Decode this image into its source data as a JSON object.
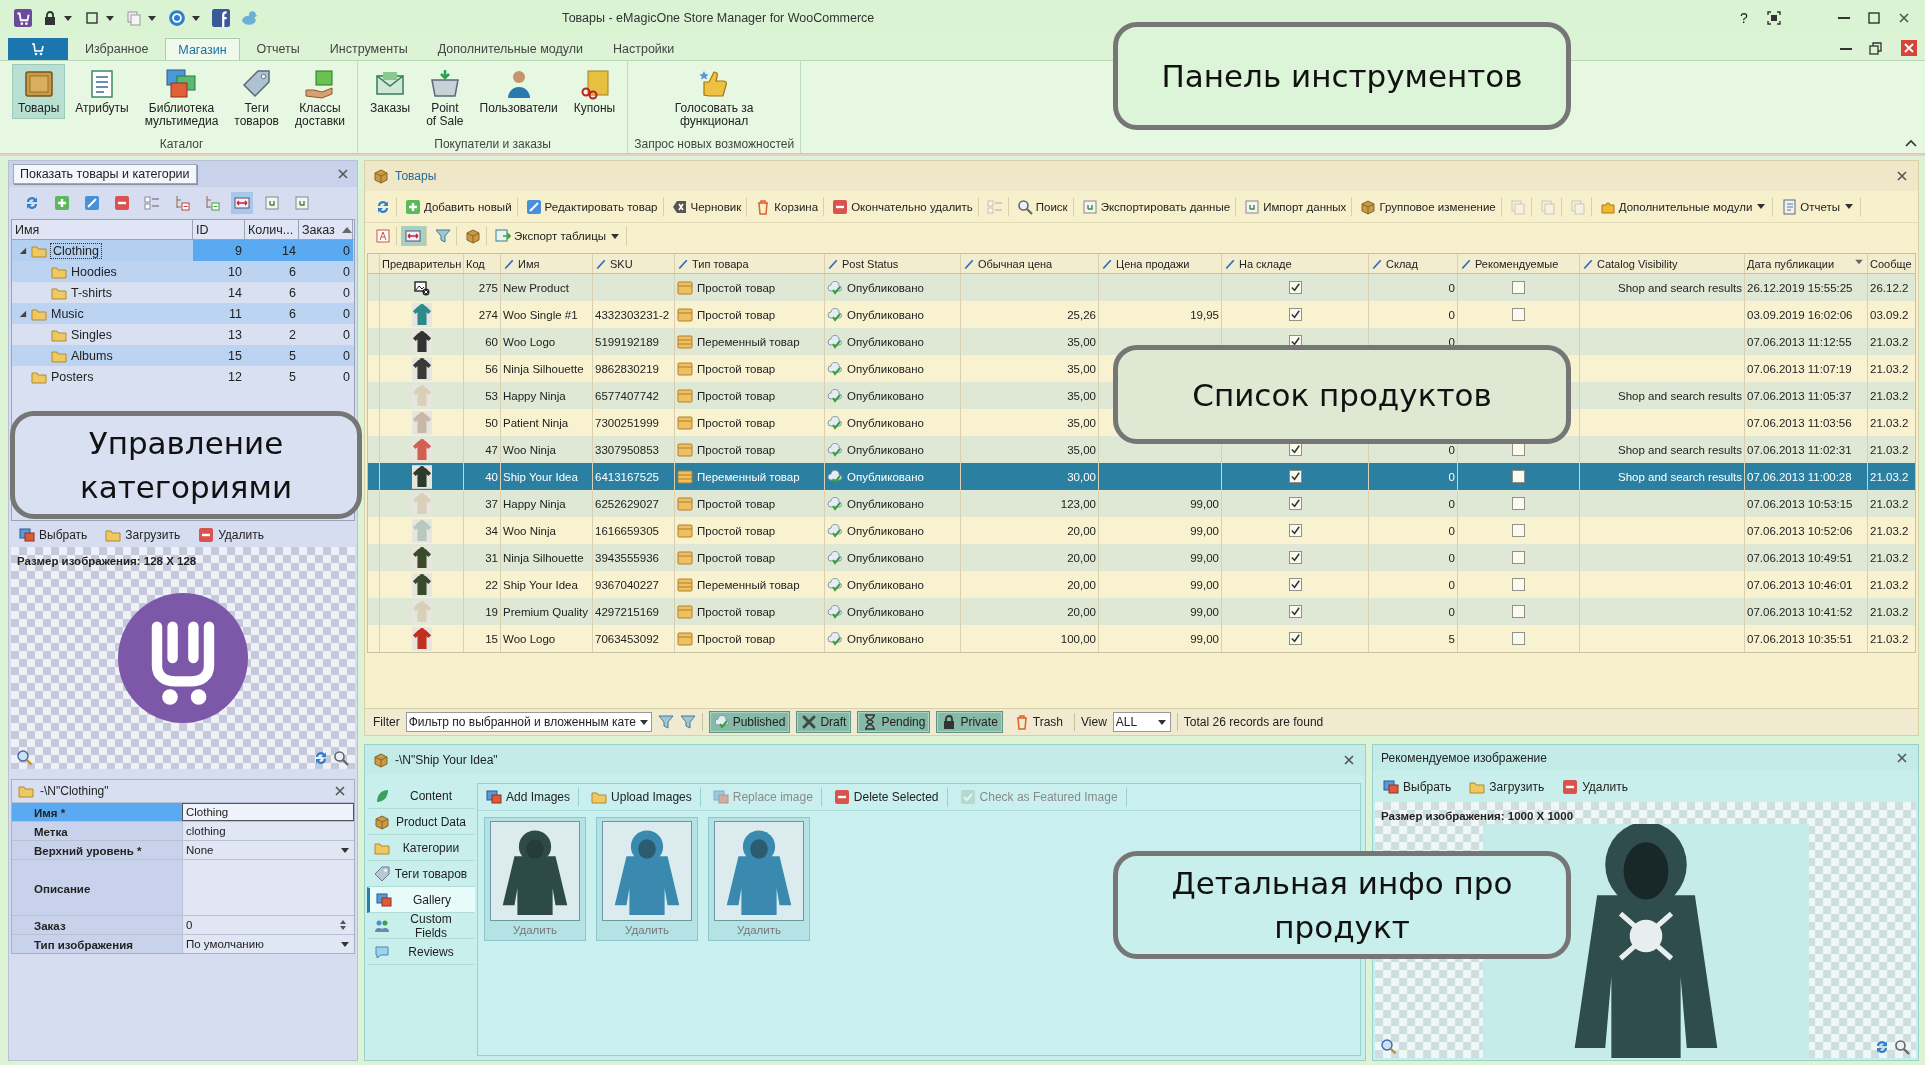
{
  "window": {
    "title": "Товары - eMagicOne Store Manager for WooCommerce",
    "help_button": "?"
  },
  "ribbon": {
    "tabs": [
      {
        "label": "Избранное",
        "selected": false
      },
      {
        "label": "Магазин",
        "selected": true
      },
      {
        "label": "Отчеты",
        "selected": false
      },
      {
        "label": "Инструменты",
        "selected": false
      },
      {
        "label": "Дополнительные модули",
        "selected": false
      },
      {
        "label": "Настройки",
        "selected": false
      }
    ],
    "groups": [
      {
        "label": "Каталог",
        "buttons": [
          {
            "label": "Товары",
            "selected": true
          },
          {
            "label": "Атрибуты",
            "selected": false
          },
          {
            "label": "Библиотека\nмультимедиа",
            "selected": false
          },
          {
            "label": "Теги\nтоваров",
            "selected": false
          },
          {
            "label": "Классы\nдоставки",
            "selected": false
          }
        ]
      },
      {
        "label": "Покупатели и заказы",
        "buttons": [
          {
            "label": "Заказы",
            "selected": false
          },
          {
            "label": "Point\nof Sale",
            "selected": false
          },
          {
            "label": "Пользователи",
            "selected": false
          },
          {
            "label": "Купоны",
            "selected": false
          }
        ]
      },
      {
        "label": "Запрос новых возможностей",
        "buttons": [
          {
            "label": "Голосовать за\nфункционал",
            "selected": false
          }
        ]
      }
    ]
  },
  "callouts": [
    "Панель инструментов",
    "Управление категориями",
    "Список продуктов",
    "Детальная инфо про продукт"
  ],
  "category_panel": {
    "title": "Показать товары и категории",
    "columns": [
      "Имя",
      "ID",
      "Колич...",
      "Заказ"
    ],
    "categories": [
      {
        "name": "Clothing",
        "id": "9",
        "count": "14",
        "order": "0",
        "selected": true,
        "expanded": true,
        "children": [
          {
            "name": "Hoodies",
            "id": "10",
            "count": "6",
            "order": "0",
            "selected": false
          },
          {
            "name": "T-shirts",
            "id": "14",
            "count": "6",
            "order": "0",
            "selected": false
          }
        ]
      },
      {
        "name": "Music",
        "id": "11",
        "count": "6",
        "order": "0",
        "selected": false,
        "expanded": true,
        "children": [
          {
            "name": "Singles",
            "id": "13",
            "count": "2",
            "order": "0",
            "selected": false
          },
          {
            "name": "Albums",
            "id": "15",
            "count": "5",
            "order": "0",
            "selected": false
          }
        ]
      },
      {
        "name": "Posters",
        "id": "12",
        "count": "5",
        "order": "0",
        "selected": false
      }
    ],
    "image_toolbar": [
      "Выбрать",
      "Загрузить",
      "Удалить"
    ],
    "image_size": "Размер изображения: 128 X 128"
  },
  "properties": {
    "title": "-\\N\"Clothing\"",
    "rows": [
      {
        "label": "Имя *",
        "value": "Clothing",
        "kind": "text",
        "selected": true
      },
      {
        "label": "Метка",
        "value": "clothing",
        "kind": "text",
        "selected": false
      },
      {
        "label": "Верхний уровень *",
        "value": "None",
        "kind": "dropdown",
        "selected": false
      },
      {
        "label": "Описание",
        "kind": "memo",
        "selected": false
      },
      {
        "label": "Заказ",
        "value": "0",
        "kind": "spin",
        "selected": false
      },
      {
        "label": "Тип изображения",
        "value": "По умолчанию",
        "kind": "dropdown",
        "selected": false
      }
    ]
  },
  "products": {
    "title": "Товары",
    "toolbar": [
      {
        "disabled": false,
        "dropdown": false
      },
      {
        "label": "Добавить новый",
        "disabled": false,
        "dropdown": false
      },
      {
        "label": "Редактировать товар",
        "disabled": false,
        "dropdown": false
      },
      {
        "label": "Черновик",
        "disabled": false,
        "dropdown": false
      },
      {
        "label": "Корзина",
        "disabled": false,
        "dropdown": false
      },
      {
        "label": "Окончательно удалить",
        "disabled": false,
        "dropdown": false
      },
      {
        "disabled": true,
        "dropdown": false
      },
      {
        "label": "Поиск",
        "disabled": false,
        "dropdown": false
      },
      {
        "label": "Экспортировать данные",
        "disabled": false,
        "dropdown": false
      },
      {
        "label": "Импорт данных",
        "disabled": false,
        "dropdown": false
      },
      {
        "label": "Групповое изменение",
        "disabled": false,
        "dropdown": false
      },
      {
        "disabled": true,
        "dropdown": false
      },
      {
        "disabled": true,
        "dropdown": false
      },
      {
        "disabled": true,
        "dropdown": false
      },
      {
        "label": "Дополнительные модули",
        "disabled": false,
        "dropdown": true
      },
      {
        "label": "Отчеты",
        "disabled": false,
        "dropdown": true
      }
    ],
    "toolbar_2": [
      {
        "selected": false,
        "dropdown": false
      },
      {
        "selected": true,
        "dropdown": false
      },
      {
        "selected": false,
        "dropdown": false
      },
      {
        "selected": false,
        "dropdown": false
      },
      {
        "label": "Экспорт таблицы",
        "selected": false,
        "dropdown": true
      }
    ],
    "columns": [
      {
        "label": "Предварительн",
        "editable": false,
        "sorted": false
      },
      {
        "label": "Код",
        "editable": false,
        "sorted": false
      },
      {
        "label": "Имя",
        "editable": true,
        "sorted": false
      },
      {
        "label": "SKU",
        "editable": true,
        "sorted": false
      },
      {
        "label": "Тип товара",
        "editable": true,
        "sorted": false
      },
      {
        "label": "Post Status",
        "editable": true,
        "sorted": false
      },
      {
        "label": "Обычная цена",
        "editable": true,
        "sorted": false
      },
      {
        "label": "Цена продажи",
        "editable": true,
        "sorted": false
      },
      {
        "label": "На складе",
        "editable": true,
        "sorted": false
      },
      {
        "label": "Склад",
        "editable": true,
        "sorted": false
      },
      {
        "label": "Рекомендуемые",
        "editable": true,
        "sorted": false
      },
      {
        "label": "Catalog Visibility",
        "editable": true,
        "sorted": false
      },
      {
        "label": "Дата публикации",
        "editable": false,
        "sorted": true
      },
      {
        "label": "Сообще",
        "editable": false,
        "sorted": false
      }
    ],
    "rows": [
      {
        "preview": {
          "kind": "missing"
        },
        "code": "275",
        "name": "New Product",
        "type": {
          "label": "Простой товар",
          "kind": "simple"
        },
        "status": "Опубликовано",
        "in_stock": true,
        "stock": "0",
        "featured": false,
        "visibility": "Shop and search results",
        "date": "26.12.2019 15:55:25",
        "column_14": "26.12.2",
        "selected": false
      },
      {
        "code": "274",
        "name": "Woo Single #1",
        "sku": "4332303231-2",
        "type": {
          "label": "Простой товар",
          "kind": "simple"
        },
        "status": "Опубликовано",
        "regular_price": "25,26",
        "sale_price": "19,95",
        "in_stock": true,
        "stock": "0",
        "featured": false,
        "date": "03.09.2019 16:02:06",
        "column_14": "03.09.2",
        "selected": false
      },
      {
        "code": "60",
        "name": "Woo Logo",
        "sku": "5199192189",
        "type": {
          "label": "Переменный товар",
          "kind": "variable"
        },
        "status": "Опубликовано",
        "regular_price": "35,00",
        "in_stock": true,
        "stock": "0",
        "date": "07.06.2013 11:12:55",
        "column_14": "21.03.2",
        "selected": false
      },
      {
        "code": "56",
        "name": "Ninja Silhouette",
        "sku": "9862830219",
        "type": {
          "label": "Простой товар",
          "kind": "simple"
        },
        "status": "Опубликовано",
        "regular_price": "35,00",
        "date": "07.06.2013 11:07:19",
        "column_14": "21.03.2",
        "selected": false
      },
      {
        "code": "53",
        "name": "Happy Ninja",
        "sku": "6577407742",
        "type": {
          "label": "Простой товар",
          "kind": "simple"
        },
        "status": "Опубликовано",
        "regular_price": "35,00",
        "visibility": "Shop and search results",
        "date": "07.06.2013 11:05:37",
        "column_14": "21.03.2",
        "selected": false
      },
      {
        "code": "50",
        "name": "Patient Ninja",
        "sku": "7300251999",
        "type": {
          "label": "Простой товар",
          "kind": "simple"
        },
        "status": "Опубликовано",
        "regular_price": "35,00",
        "date": "07.06.2013 11:03:56",
        "column_14": "21.03.2",
        "selected": false
      },
      {
        "code": "47",
        "name": "Woo Ninja",
        "sku": "3307950853",
        "type": {
          "label": "Простой товар",
          "kind": "simple"
        },
        "status": "Опубликовано",
        "regular_price": "35,00",
        "in_stock": true,
        "stock": "0",
        "featured": false,
        "visibility": "Shop and search results",
        "date": "07.06.2013 11:02:31",
        "column_14": "21.03.2",
        "selected": false
      },
      {
        "code": "40",
        "name": "Ship Your Idea",
        "sku": "6413167525",
        "type": {
          "label": "Переменный товар",
          "kind": "variable"
        },
        "status": "Опубликовано",
        "regular_price": "30,00",
        "in_stock": true,
        "stock": "0",
        "featured": false,
        "visibility": "Shop and search results",
        "date": "07.06.2013 11:00:28",
        "column_14": "21.03.2",
        "selected": true
      },
      {
        "code": "37",
        "name": "Happy Ninja",
        "sku": "6252629027",
        "type": {
          "label": "Простой товар",
          "kind": "simple"
        },
        "status": "Опубликовано",
        "regular_price": "123,00",
        "sale_price": "99,00",
        "in_stock": true,
        "stock": "0",
        "featured": false,
        "date": "07.06.2013 10:53:15",
        "column_14": "21.03.2",
        "selected": false
      },
      {
        "code": "34",
        "name": "Woo Ninja",
        "sku": "1616659305",
        "type": {
          "label": "Простой товар",
          "kind": "simple"
        },
        "status": "Опубликовано",
        "regular_price": "20,00",
        "sale_price": "99,00",
        "in_stock": true,
        "stock": "0",
        "featured": false,
        "date": "07.06.2013 10:52:06",
        "column_14": "21.03.2",
        "selected": false
      },
      {
        "code": "31",
        "name": "Ninja Silhouette",
        "sku": "3943555936",
        "type": {
          "label": "Простой товар",
          "kind": "simple"
        },
        "status": "Опубликовано",
        "regular_price": "20,00",
        "sale_price": "99,00",
        "in_stock": true,
        "stock": "0",
        "featured": false,
        "date": "07.06.2013 10:49:51",
        "column_14": "21.03.2",
        "selected": false
      },
      {
        "code": "22",
        "name": "Ship Your Idea",
        "sku": "9367040227",
        "type": {
          "label": "Переменный товар",
          "kind": "variable"
        },
        "status": "Опубликовано",
        "regular_price": "20,00",
        "sale_price": "99,00",
        "in_stock": true,
        "stock": "0",
        "featured": false,
        "date": "07.06.2013 10:46:01",
        "column_14": "21.03.2",
        "selected": false
      },
      {
        "code": "19",
        "name": "Premium Quality",
        "sku": "4297215169",
        "type": {
          "label": "Простой товар",
          "kind": "simple"
        },
        "status": "Опубликовано",
        "regular_price": "20,00",
        "sale_price": "99,00",
        "in_stock": true,
        "stock": "0",
        "featured": false,
        "date": "07.06.2013 10:41:52",
        "column_14": "21.03.2",
        "selected": false
      },
      {
        "code": "15",
        "name": "Woo Logo",
        "sku": "7063453092",
        "type": {
          "label": "Простой товар",
          "kind": "simple"
        },
        "status": "Опубликовано",
        "regular_price": "100,00",
        "sale_price": "99,00",
        "in_stock": true,
        "stock": "5",
        "featured": false,
        "date": "07.06.2013 10:35:51",
        "column_14": "21.03.2",
        "selected": false
      }
    ],
    "filter_bar": {
      "label": "Filter",
      "value": "Фильтр по выбранной и вложенным кате",
      "statuses": [
        {
          "label": "Published",
          "selected": true
        },
        {
          "label": "Draft",
          "selected": true
        },
        {
          "label": "Pending",
          "selected": true
        },
        {
          "label": "Private",
          "selected": true
        },
        {
          "label": "Trash",
          "selected": false
        }
      ],
      "view_label": "View",
      "view_value": "ALL",
      "total": "Total 26 records are found"
    }
  },
  "detail": {
    "title": "-\\N\"Ship Your Idea\"",
    "tabs": [
      {
        "label": "Content",
        "selected": false
      },
      {
        "label": "Product Data",
        "selected": false
      },
      {
        "label": "Категории",
        "selected": false
      },
      {
        "label": "Теги товаров",
        "selected": false
      },
      {
        "label": "Gallery",
        "selected": true
      },
      {
        "label": "Custom Fields",
        "selected": false
      },
      {
        "label": "Reviews",
        "selected": false
      }
    ],
    "toolbar": [
      {
        "label": "Add Images",
        "disabled": false
      },
      {
        "label": "Upload Images",
        "disabled": false
      },
      {
        "label": "Replace image",
        "disabled": true
      },
      {
        "label": "Delete Selected",
        "disabled": false
      },
      {
        "label": "Check as Featured Image",
        "disabled": true
      }
    ],
    "gallery": [
      {
        "kind": "picture",
        "delete_label": "Удалить"
      },
      {
        "kind": "picture",
        "delete_label": "Удалить"
      },
      {
        "kind": "picture",
        "delete_label": "Удалить"
      }
    ]
  },
  "featured_image": {
    "title": "Рекомендуемое изображение",
    "toolbar": [
      "Выбрать",
      "Загрузить",
      "Удалить"
    ],
    "image_size": "Размер изображения: 1000 X 1000"
  }
}
